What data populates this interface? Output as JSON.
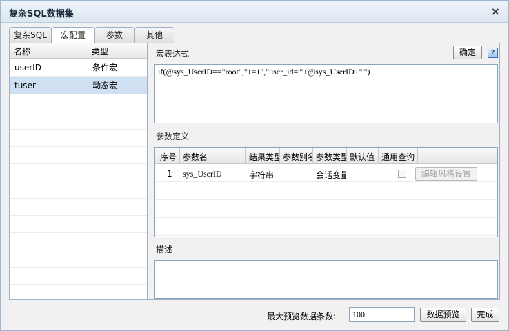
{
  "dialog": {
    "title": "复杂SQL数据集",
    "close_glyph": "×"
  },
  "tabs": [
    "复杂SQL",
    "宏配置",
    "参数",
    "其他"
  ],
  "macro_list": {
    "headers": [
      "名称",
      "类型"
    ],
    "rows": [
      {
        "name": "userID",
        "type": "条件宏"
      },
      {
        "name": "tuser",
        "type": "动态宏"
      }
    ]
  },
  "macro_expr": {
    "label": "宏表达式",
    "ok_label": "确定",
    "value": "if(@sys_UserID==\"root\",\"1=1\",\"user_id='\"+@sys_UserID+\"'\")"
  },
  "params": {
    "label": "参数定义",
    "headers": [
      "序号",
      "参数名",
      "结果类型",
      "参数别名",
      "参数类型",
      "默认值",
      "通用查询"
    ],
    "rows": [
      {
        "index": "1",
        "name": "sys_UserID",
        "result_type": "字符串",
        "alias": "",
        "param_type": "会话变量",
        "default": "",
        "style_button": "编辑风格设置"
      }
    ]
  },
  "description": {
    "label": "描述",
    "value": ""
  },
  "footer": {
    "max_preview_label": "最大预览数据条数:",
    "max_preview_value": "100",
    "preview_label": "数据预览",
    "finish_label": "完成"
  }
}
